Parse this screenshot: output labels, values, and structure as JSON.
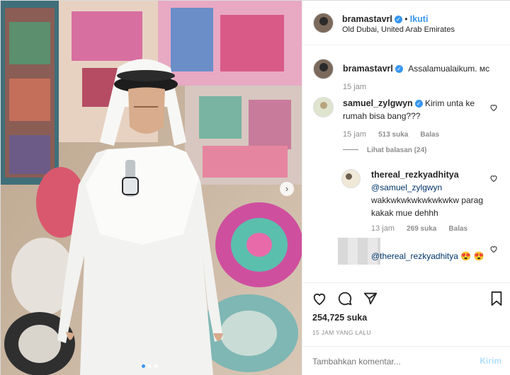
{
  "post": {
    "username": "bramastavrl",
    "follow_label": "Ikuti",
    "location": "Old Dubai, United Arab Emirates",
    "caption": "Assalamualaikum. мс",
    "caption_time": "15 jam",
    "likes": "254,725 suka",
    "timestamp": "15 JAM YANG LALU",
    "comment_placeholder": "Tambahkan komentar...",
    "send_label": "Kirim",
    "carousel_dots": 3
  },
  "comments": [
    {
      "username": "samuel_zylgwyn",
      "verified": true,
      "text": "Kirim unta ke rumah bisa bang???",
      "time": "15 jam",
      "likes": "513 suka",
      "reply": "Balas",
      "view_replies": "Lihat balasan (24)"
    },
    {
      "username": "thereal_rezkyadhitya",
      "verified": false,
      "mention": "@samuel_zylgwyn",
      "text": "wakkwkwkwkwkwkwkw parag kakak mue dehhh",
      "time": "13 jam",
      "likes": "269 suka",
      "reply": "Balas"
    },
    {
      "username": "",
      "verified": false,
      "mention": "@thereal_rezkyadhitya",
      "text": "😍 😍"
    }
  ],
  "colors": {
    "accent": "#3897f0",
    "muted": "#8e8e8e",
    "border": "#efefef"
  },
  "icons": [
    "heart-icon",
    "comment-icon",
    "share-icon",
    "bookmark-icon",
    "verified-badge-icon",
    "carousel-next-icon"
  ]
}
